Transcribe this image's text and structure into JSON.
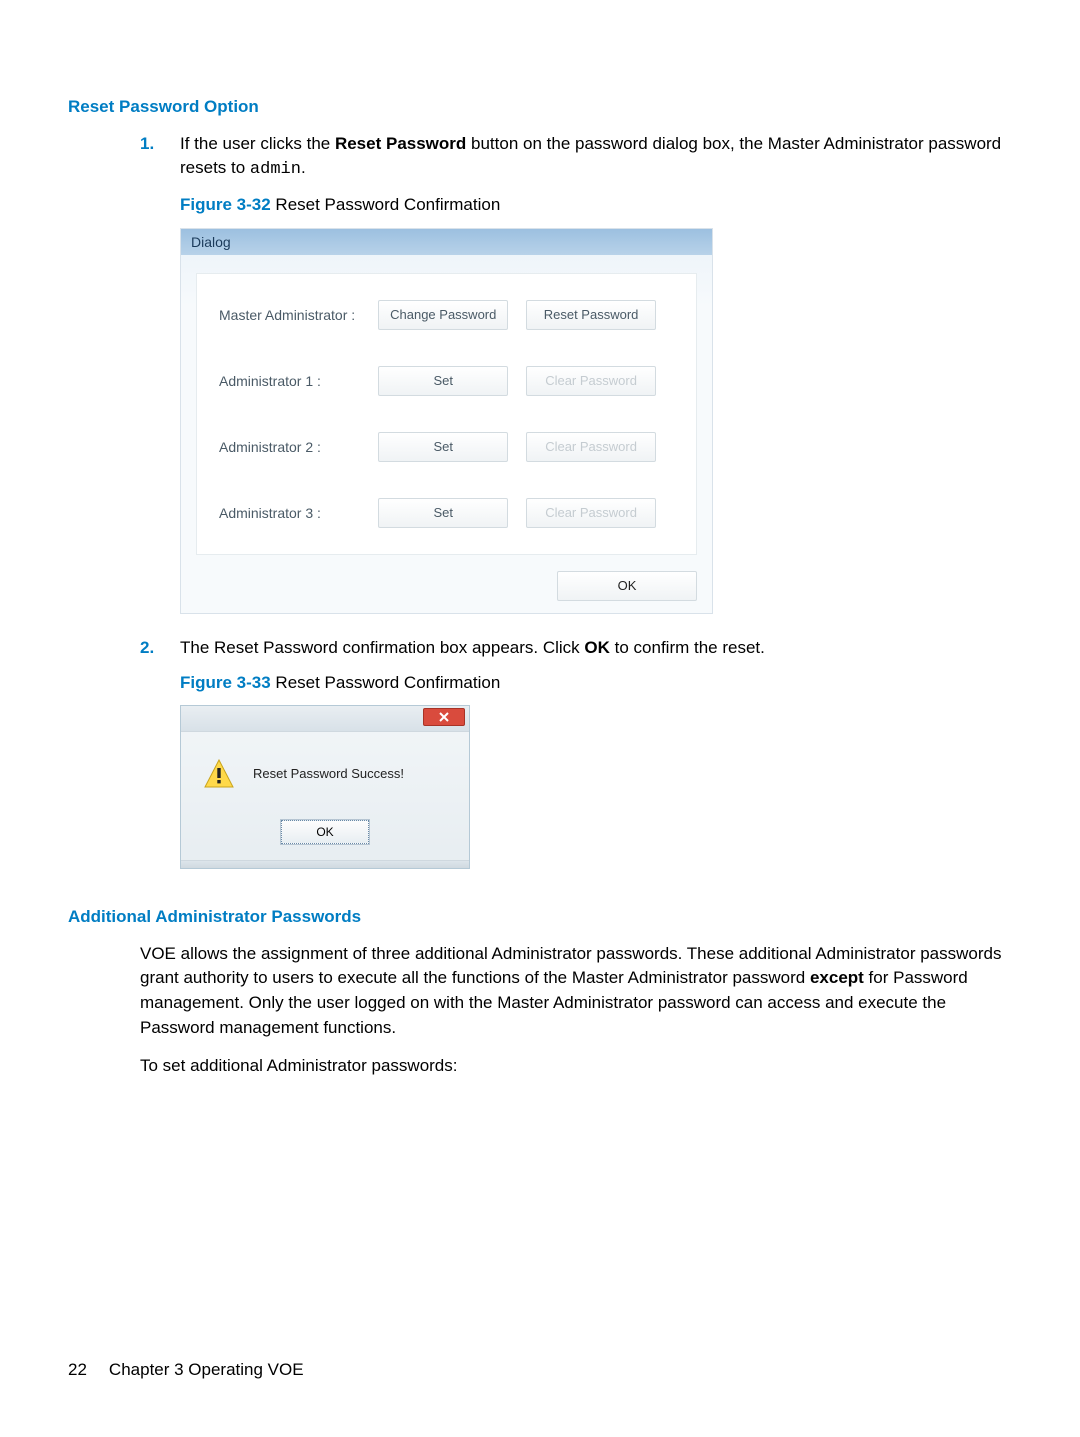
{
  "headings": {
    "reset_option": "Reset Password Option",
    "additional": "Additional Administrator Passwords"
  },
  "step1": {
    "marker": "1.",
    "text_a": "If the user clicks the ",
    "text_bold": "Reset Password",
    "text_b": " button on the password dialog box, the Master Administrator password resets to ",
    "text_mono": "admin",
    "text_c": "."
  },
  "fig32": {
    "label": "Figure 3-32",
    "caption": "  Reset Password Confirmation"
  },
  "dialog": {
    "title": "Dialog",
    "rows": [
      {
        "label": "Master Administrator :",
        "btn1": "Change Password",
        "btn2": "Reset Password",
        "btn2_disabled": false
      },
      {
        "label": "Administrator 1 :",
        "btn1": "Set",
        "btn2": "Clear Password",
        "btn2_disabled": true
      },
      {
        "label": "Administrator 2 :",
        "btn1": "Set",
        "btn2": "Clear Password",
        "btn2_disabled": true
      },
      {
        "label": "Administrator 3 :",
        "btn1": "Set",
        "btn2": "Clear Password",
        "btn2_disabled": true
      }
    ],
    "ok": "OK"
  },
  "step2": {
    "marker": "2.",
    "text_a": "The Reset Password confirmation box appears. Click ",
    "text_bold": "OK",
    "text_b": " to confirm the reset."
  },
  "fig33": {
    "label": "Figure 3-33",
    "caption": "  Reset Password Confirmation"
  },
  "msgbox": {
    "text": "Reset Password Success!",
    "ok": "OK"
  },
  "additional_para": {
    "pre": "VOE allows the assignment of three additional Administrator passwords. These additional Administrator passwords grant authority to users to execute all the functions of the Master Administrator password ",
    "bold": "except",
    "post": " for Password management. Only the user logged on with the Master Administrator password can access and execute the Password management functions."
  },
  "additional_para2": "To set additional Administrator passwords:",
  "footer": {
    "pagenum": "22",
    "chapter": "Chapter 3   Operating VOE"
  }
}
